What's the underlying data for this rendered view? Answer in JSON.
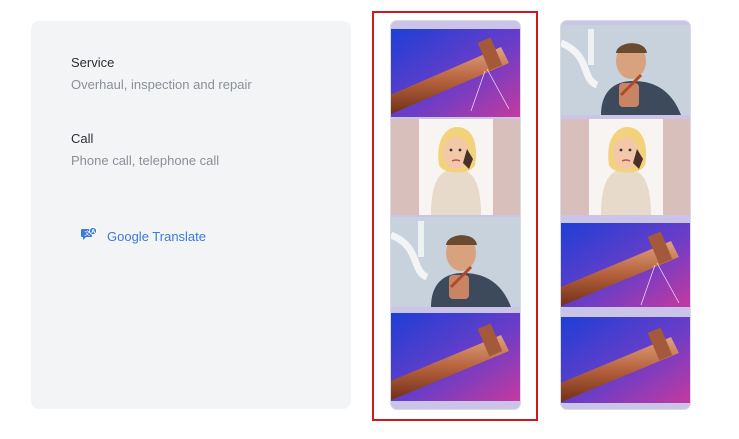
{
  "entries": [
    {
      "title": "Service",
      "description": "Overhaul, inspection and repair"
    },
    {
      "title": "Call",
      "description": "Phone call, telephone call"
    }
  ],
  "translate": {
    "label": "Google Translate",
    "icon": "translate-icon"
  },
  "colors": {
    "panel_bg": "#f3f4f6",
    "link_blue": "#3b7bd6",
    "selection_red": "#d0191b"
  },
  "strips": [
    {
      "selected": true,
      "tiles": [
        "copper-pipe-image",
        "woman-on-phone-image",
        "plumber-with-pipe-image",
        "copper-pipe-image"
      ]
    },
    {
      "selected": false,
      "tiles": [
        "plumber-with-pipe-image",
        "woman-on-phone-image",
        "copper-pipe-image",
        "copper-pipe-image"
      ]
    }
  ]
}
